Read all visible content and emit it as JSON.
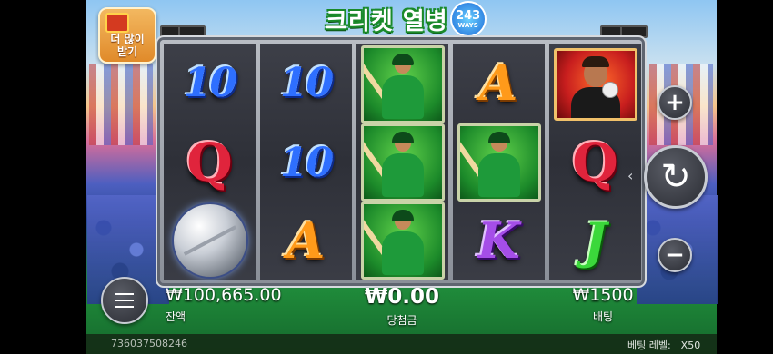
{
  "game": {
    "title": "크리켓 열병",
    "ways_number": "243",
    "ways_label": "WAYS"
  },
  "promo": {
    "label_line1": "더 많이",
    "label_line2": "받기"
  },
  "reels": [
    [
      "10",
      "Q",
      "ball"
    ],
    [
      "10",
      "10",
      "A"
    ],
    [
      "batsman",
      "batsman",
      "batsman"
    ],
    [
      "A",
      "batsman",
      "K"
    ],
    [
      "captain",
      "Q",
      "J"
    ]
  ],
  "symbol_text": {
    "r0c0": "10",
    "r1c0": "Q",
    "r0c1": "10",
    "r1c1": "10",
    "r2c1": "A",
    "r0c3": "A",
    "r2c3": "K",
    "r1c4": "Q",
    "r2c4": "J"
  },
  "hud": {
    "balance_value": "₩100,665.00",
    "balance_label": "잔액",
    "win_value": "₩0.00",
    "win_label": "당첨금",
    "bet_value": "₩1500",
    "bet_label": "배팅"
  },
  "controls": {
    "plus_symbol": "+",
    "minus_symbol": "−",
    "spin_symbol": "↻",
    "spin_arrow": "‹"
  },
  "footer": {
    "round_id": "736037508246",
    "bet_level": "베팅 레벨:　X50"
  },
  "colors": {
    "ten": "#2e6fff",
    "queen": "#e0243c",
    "ace": "#ff9a1a",
    "king": "#a54ee8",
    "jack": "#3bd83b",
    "player_tile": "#1c8a2a",
    "captain_tile": "#c81e1e"
  }
}
